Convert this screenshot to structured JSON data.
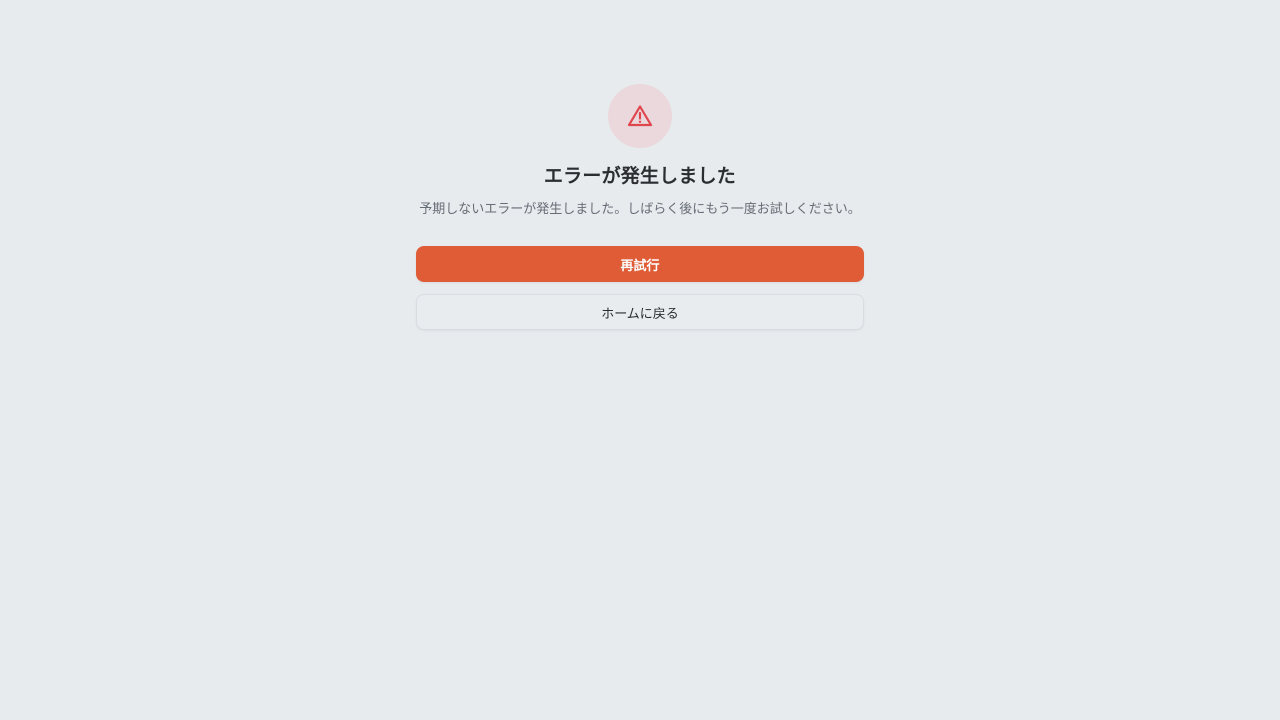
{
  "error": {
    "icon": "alert-triangle-icon",
    "title": "エラーが発生しました",
    "message": "予期しないエラーが発生しました。しばらく後にもう一度お試しください。"
  },
  "actions": {
    "retry_label": "再試行",
    "home_label": "ホームに戻る"
  },
  "colors": {
    "background": "#e7ebee",
    "icon_circle": "#ead8dc",
    "icon_stroke": "#e0464e",
    "primary_button": "#e05c37",
    "secondary_button": "#e9ecef",
    "title_text": "#2b2d31",
    "message_text": "#676d76"
  }
}
